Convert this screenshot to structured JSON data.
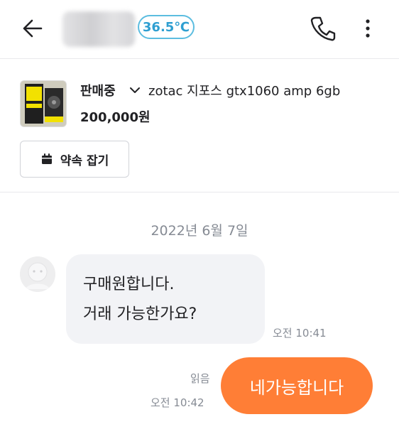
{
  "header": {
    "manner_temp": "36.5℃",
    "icons": {
      "back": "arrow-left-icon",
      "call": "phone-icon",
      "more": "more-vertical-icon"
    },
    "colors": {
      "temp_border": "#5cbde0",
      "temp_text": "#2f9fd1"
    }
  },
  "product": {
    "status": "판매중",
    "title": "zotac 지포스 gtx1060 amp 6gb",
    "price": "200,000원",
    "appointment_label": "약속 잡기",
    "icons": {
      "status_toggle": "chevron-down-icon",
      "appointment": "calendar-icon"
    }
  },
  "chat": {
    "date": "2022년 6월 7일",
    "incoming": {
      "lines": [
        "구매원합니다.",
        "거래 가능한가요?"
      ],
      "time": "오전 10:41"
    },
    "outgoing": {
      "text": "네가능합니다",
      "read_status": "읽음",
      "time": "오전 10:42"
    },
    "colors": {
      "accent": "#ff7e36",
      "incoming_bg": "#f2f3f6",
      "meta_text": "#868b94"
    }
  }
}
